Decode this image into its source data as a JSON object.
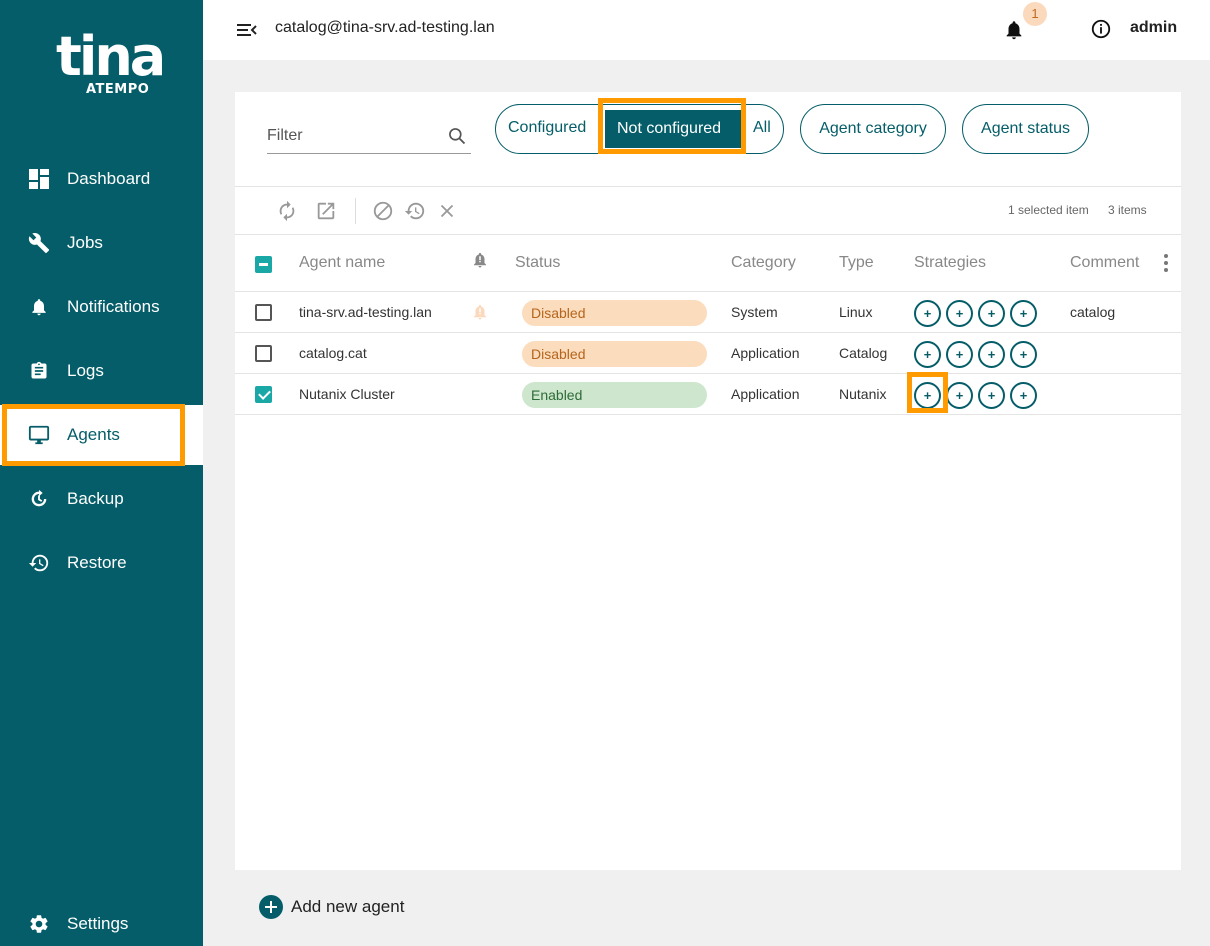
{
  "brand": {
    "logo_word": "tina",
    "logo_sub": "ATEMPO"
  },
  "sidebar": {
    "items": [
      {
        "label": "Dashboard",
        "icon": "dashboard-icon"
      },
      {
        "label": "Jobs",
        "icon": "wrench-icon"
      },
      {
        "label": "Notifications",
        "icon": "bell-icon"
      },
      {
        "label": "Logs",
        "icon": "clipboard-icon"
      },
      {
        "label": "Agents",
        "icon": "monitor-icon",
        "active": true
      },
      {
        "label": "Backup",
        "icon": "backup-icon"
      },
      {
        "label": "Restore",
        "icon": "restore-icon"
      },
      {
        "label": "Settings",
        "icon": "gear-icon"
      }
    ]
  },
  "topbar": {
    "host": "catalog@tina-srv.ad-testing.lan",
    "notification_count": "1",
    "user": "admin"
  },
  "filters": {
    "search_placeholder": "Filter",
    "segments": [
      "Configured",
      "Not configured",
      "All"
    ],
    "selected_segment": "Not configured",
    "agent_category": "Agent category",
    "agent_status": "Agent status"
  },
  "toolbar": {
    "selected_text": "1 selected item",
    "items_text": "3 items"
  },
  "table": {
    "columns": [
      "Agent name",
      "Status",
      "Category",
      "Type",
      "Strategies",
      "Comment"
    ],
    "rows": [
      {
        "name": "tina-srv.ad-testing.lan",
        "status": "Disabled",
        "category": "System",
        "type": "Linux",
        "comment": "catalog",
        "checked": false,
        "alert": true
      },
      {
        "name": "catalog.cat",
        "status": "Disabled",
        "category": "Application",
        "type": "Catalog",
        "comment": "",
        "checked": false,
        "alert": false
      },
      {
        "name": "Nutanix Cluster",
        "status": "Enabled",
        "category": "Application",
        "type": "Nutanix",
        "comment": "",
        "checked": true,
        "alert": false
      }
    ],
    "strategy_symbol": "+"
  },
  "footer": {
    "add_agent": "Add new agent"
  },
  "colors": {
    "primary": "#045d68",
    "accent": "#19a8a6",
    "highlight": "#ff9a00",
    "disabled_bg": "#fbdcbc",
    "enabled_bg": "#cde6cd"
  }
}
